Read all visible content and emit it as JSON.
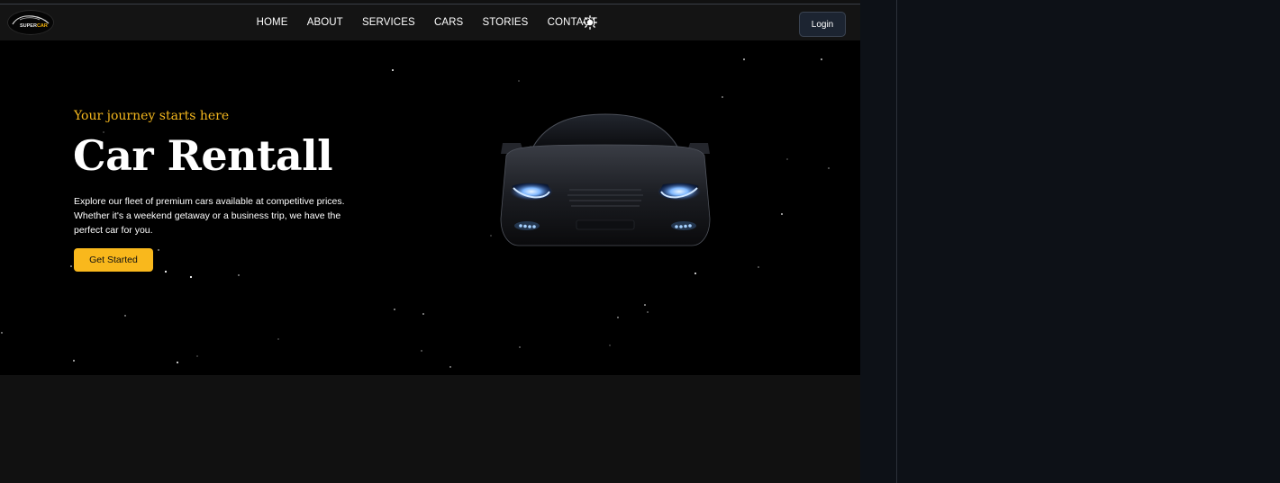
{
  "brand": {
    "logo_word_1": "SUPER",
    "logo_word_2": "CAR"
  },
  "nav": {
    "items": [
      "HOME",
      "ABOUT",
      "SERVICES",
      "CARS",
      "STORIES",
      "CONTACT"
    ],
    "theme_icon": "sun-icon",
    "login_label": "Login"
  },
  "hero": {
    "tagline": "Your journey starts here",
    "title": "Car Rentall",
    "description": "Explore our fleet of premium cars available at competitive prices. Whether it's a weekend getaway or a business trip, we have the perfect car for you.",
    "cta_label": "Get Started",
    "image": "sports-car-front-headlights"
  },
  "colors": {
    "accent": "#f9b81c",
    "tagline": "#f4b71d",
    "hero_bg": "#000000",
    "nav_bg": "#141414",
    "page_bg": "#111111",
    "outer_bg": "#0d1117"
  }
}
